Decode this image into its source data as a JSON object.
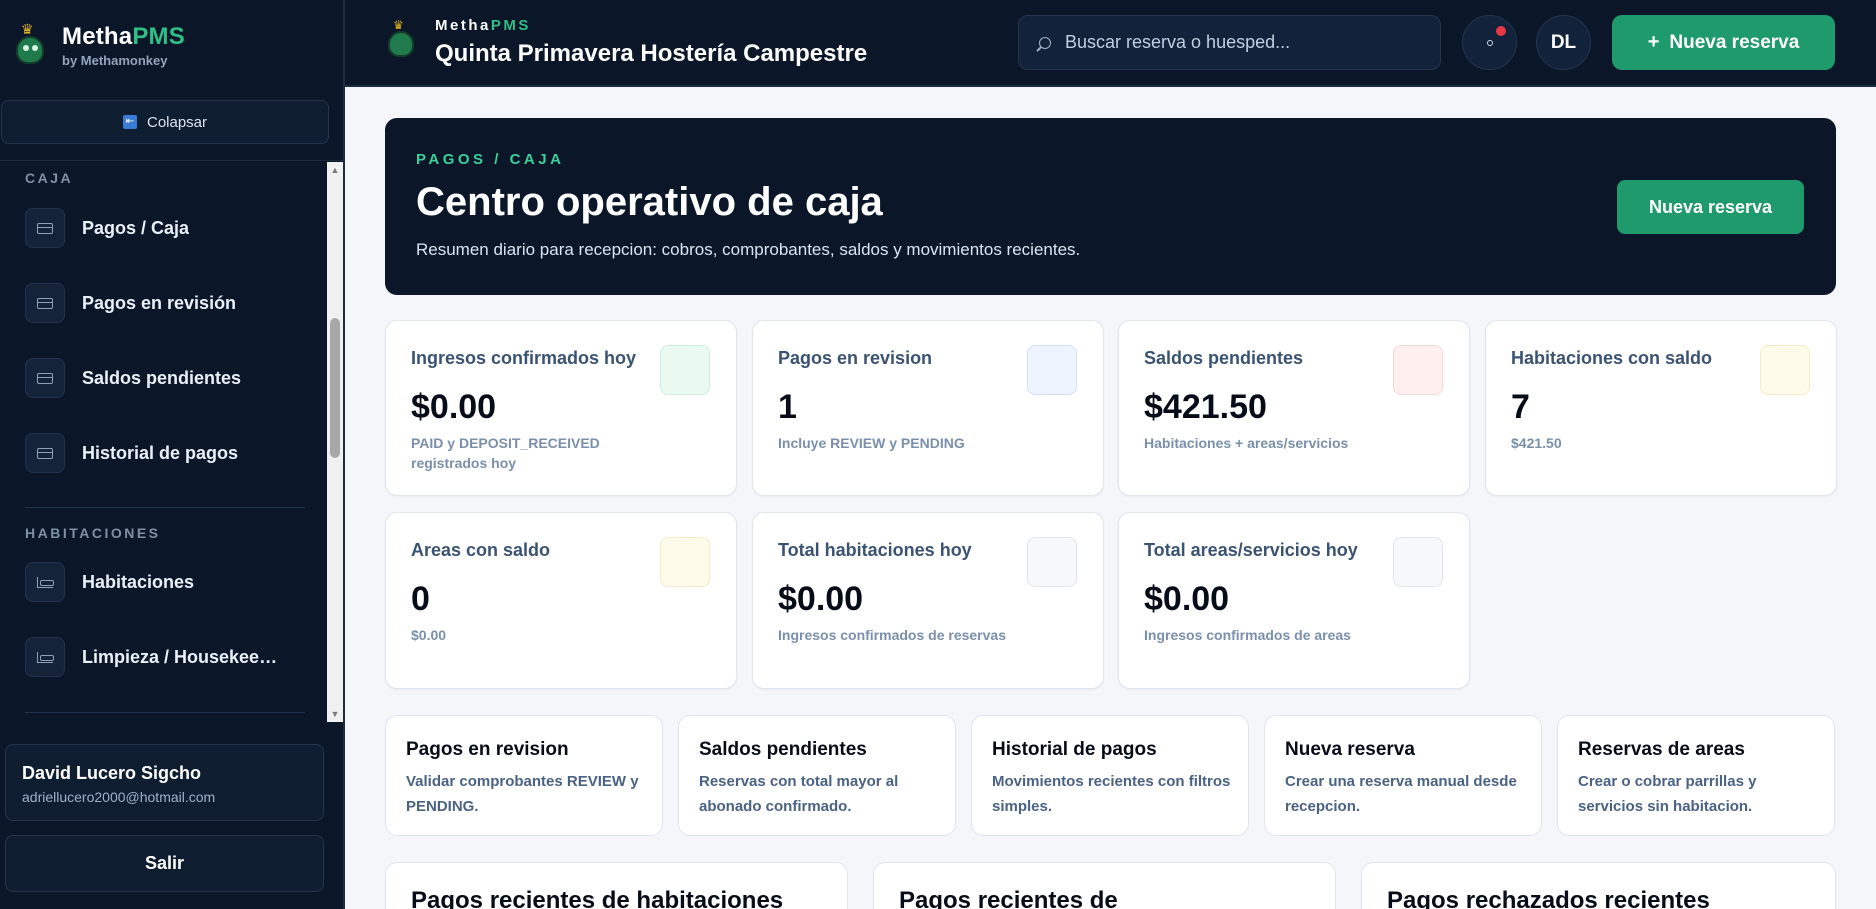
{
  "brand": {
    "name_main": "Metha",
    "name_accent": "PMS",
    "by": "by Methamonkey"
  },
  "sidebar": {
    "collapse_label": "Colapsar",
    "sections": [
      {
        "title": "CAJA",
        "items": [
          {
            "label": "Pagos / Caja",
            "icon": "card-icon"
          },
          {
            "label": "Pagos en revisión",
            "icon": "card-icon"
          },
          {
            "label": "Saldos pendientes",
            "icon": "card-icon"
          },
          {
            "label": "Historial de pagos",
            "icon": "card-icon"
          }
        ]
      },
      {
        "title": "HABITACIONES",
        "items": [
          {
            "label": "Habitaciones",
            "icon": "bed-icon"
          },
          {
            "label": "Limpieza / Housekeeping",
            "icon": "bed-icon"
          }
        ]
      }
    ],
    "user": {
      "name": "David Lucero Sigcho",
      "email": "adriellucero2000@hotmail.com"
    },
    "logout_label": "Salir"
  },
  "topbar": {
    "brand_main": "Metha",
    "brand_accent": "PMS",
    "property_name": "Quinta Primavera Hostería Campestre",
    "search_placeholder": "Buscar reserva o huesped...",
    "avatar_initials": "DL",
    "new_reservation_label": "Nueva reserva"
  },
  "hero": {
    "eyebrow": "PAGOS / CAJA",
    "title": "Centro operativo de caja",
    "subtitle": "Resumen diario para recepcion: cobros, comprobantes, saldos y movimientos recientes.",
    "button_label": "Nueva reserva"
  },
  "stats": [
    {
      "label": "Ingresos confirmados hoy",
      "value": "$0.00",
      "hint": "PAID y DEPOSIT_RECEIVED registrados hoy",
      "icon_bg": "#eafaf1",
      "icon_border": "#cdeedd"
    },
    {
      "label": "Pagos en revision",
      "value": "1",
      "hint": "Incluye REVIEW y PENDING",
      "icon_bg": "#eef4ff",
      "icon_border": "#d3e0f7"
    },
    {
      "label": "Saldos pendientes",
      "value": "$421.50",
      "hint": "Habitaciones + areas/servicios",
      "icon_bg": "#fff0f0",
      "icon_border": "#f6d7d7"
    },
    {
      "label": "Habitaciones con saldo",
      "value": "7",
      "hint": "$421.50",
      "icon_bg": "#fffbea",
      "icon_border": "#f4ebc8"
    },
    {
      "label": "Areas con saldo",
      "value": "0",
      "hint": "$0.00",
      "icon_bg": "#fffbea",
      "icon_border": "#f4ebc8"
    },
    {
      "label": "Total habitaciones hoy",
      "value": "$0.00",
      "hint": "Ingresos confirmados de reservas",
      "icon_bg": "#f7f8fa",
      "icon_border": "#e2e6ec"
    },
    {
      "label": "Total areas/servicios hoy",
      "value": "$0.00",
      "hint": "Ingresos confirmados de areas",
      "icon_bg": "#f7f8fa",
      "icon_border": "#e2e6ec"
    }
  ],
  "actions": [
    {
      "title": "Pagos en revision",
      "desc": "Validar comprobantes REVIEW y PENDING."
    },
    {
      "title": "Saldos pendientes",
      "desc": "Reservas con total mayor al abonado confirmado."
    },
    {
      "title": "Historial de pagos",
      "desc": "Movimientos recientes con filtros simples."
    },
    {
      "title": "Nueva reserva",
      "desc": "Crear una reserva manual desde recepcion."
    },
    {
      "title": "Reservas de areas",
      "desc": "Crear o cobrar parrillas y servicios sin habitacion."
    }
  ],
  "recent_panels": [
    {
      "title": "Pagos recientes de habitaciones"
    },
    {
      "title": "Pagos recientes de"
    },
    {
      "title": "Pagos rechazados recientes"
    }
  ],
  "colors": {
    "sidebar_bg": "#0b1729",
    "accent_green": "#1f9a6c",
    "brand_accent": "#2fbf86",
    "notification_dot": "#e53946"
  }
}
